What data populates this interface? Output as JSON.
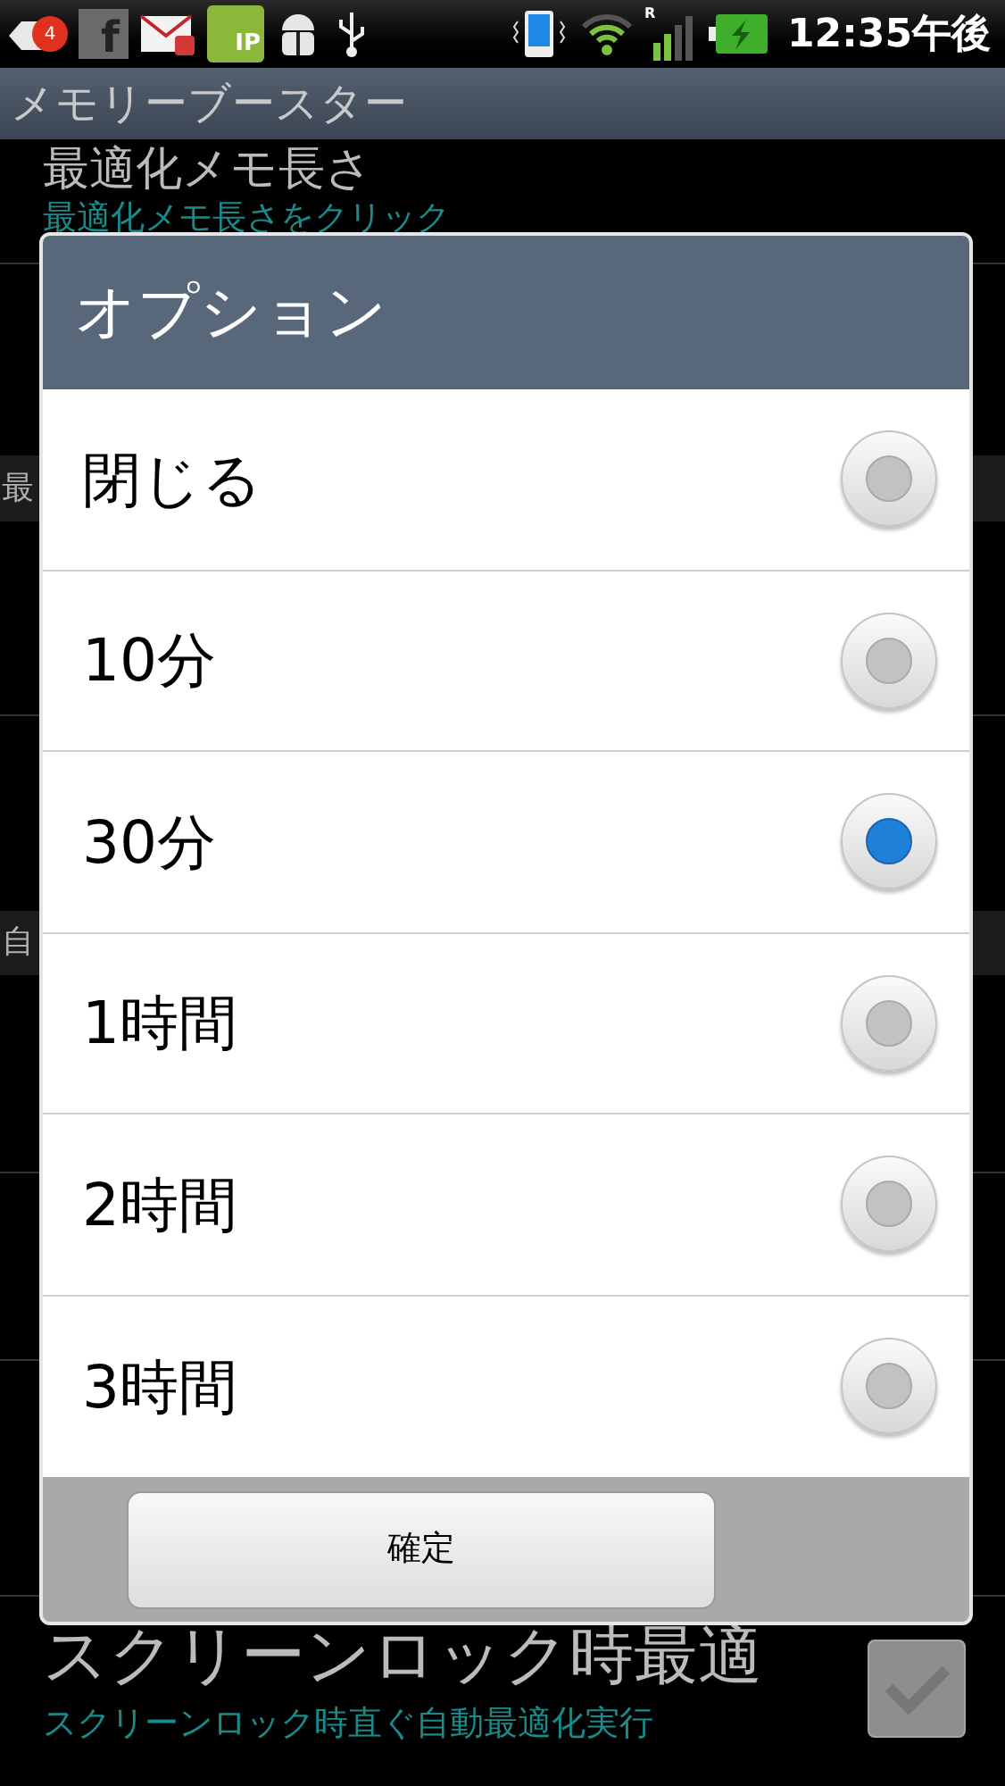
{
  "status_bar": {
    "badge": "4",
    "app_letter": "f",
    "call_label": "IP",
    "roaming": "R",
    "time": "12:35午後"
  },
  "app_title": "メモリーブースター",
  "background": {
    "top_item": {
      "title": "最適化メモ長さ",
      "summary": "最適化メモ長さをクリック"
    },
    "section_headers": [
      "最",
      "自"
    ],
    "bottom_item": {
      "title": "スクリーンロック時最適",
      "summary": "スクリーンロック時直ぐ自動最適化実行",
      "checked": true
    }
  },
  "dialog": {
    "title": "オプション",
    "options": [
      {
        "label": "閉じる",
        "selected": false
      },
      {
        "label": "10分",
        "selected": false
      },
      {
        "label": "30分",
        "selected": true
      },
      {
        "label": "1時間",
        "selected": false
      },
      {
        "label": "2時間",
        "selected": false
      },
      {
        "label": "3時間",
        "selected": false
      }
    ],
    "confirm": "確定"
  }
}
